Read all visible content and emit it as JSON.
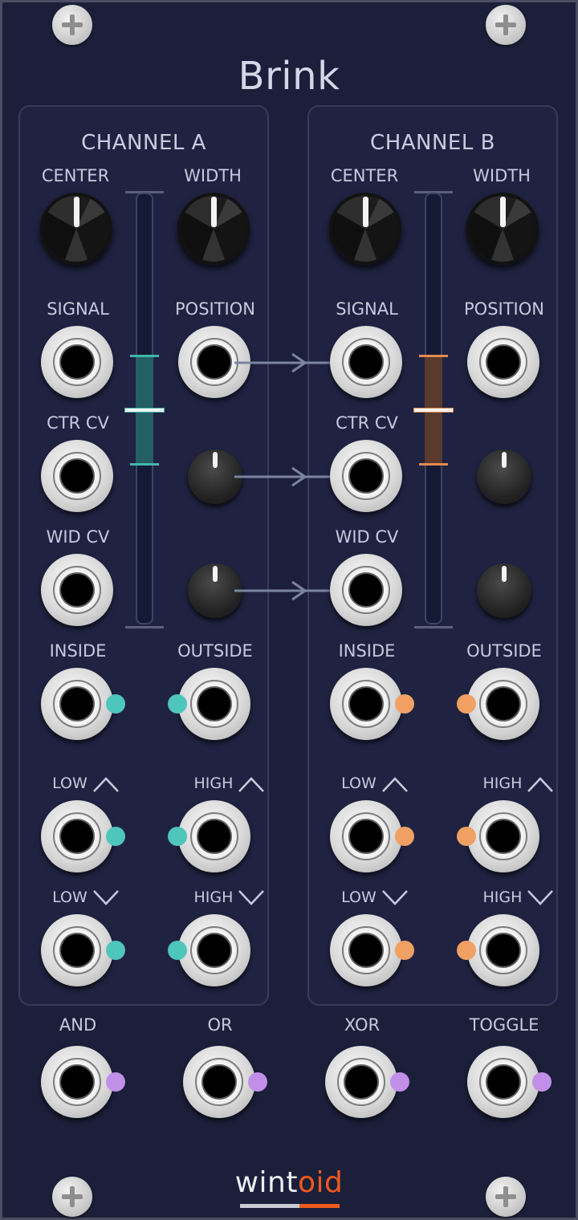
{
  "module": {
    "title": "Brink",
    "brand": {
      "part1": "wint",
      "part2": "oid"
    },
    "colors": {
      "panel": "#1c1f3a",
      "channel_a_accent": "#4fc6bb",
      "channel_b_accent": "#f0a062",
      "logic_accent": "#c18fe8",
      "brand_accent": "#ee5a1e"
    }
  },
  "channel_a": {
    "title": "CHANNEL A",
    "labels": {
      "center": "CENTER",
      "width": "WIDTH",
      "signal": "SIGNAL",
      "position": "POSITION",
      "ctr_cv": "CTR CV",
      "wid_cv": "WID CV",
      "inside": "INSIDE",
      "outside": "OUTSIDE",
      "low_rise": "LOW",
      "high_rise": "HIGH",
      "low_fall": "LOW",
      "high_fall": "HIGH"
    }
  },
  "channel_b": {
    "title": "CHANNEL B",
    "labels": {
      "center": "CENTER",
      "width": "WIDTH",
      "signal": "SIGNAL",
      "position": "POSITION",
      "ctr_cv": "CTR CV",
      "wid_cv": "WID CV",
      "inside": "INSIDE",
      "outside": "OUTSIDE",
      "low_rise": "LOW",
      "high_rise": "HIGH",
      "low_fall": "LOW",
      "high_fall": "HIGH"
    }
  },
  "logic": {
    "and": "AND",
    "or": "OR",
    "xor": "XOR",
    "toggle": "TOGGLE"
  },
  "icons": [
    "screw-icon",
    "rising-edge-icon",
    "falling-edge-icon",
    "normalled-arrow-icon"
  ]
}
